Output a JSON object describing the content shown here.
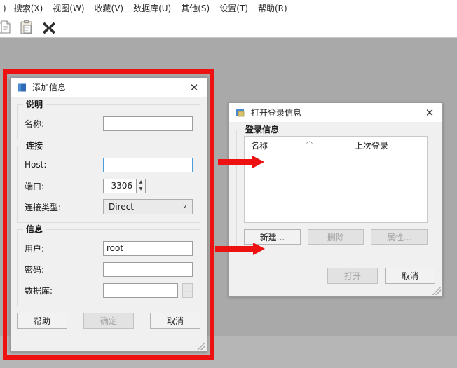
{
  "menubar": {
    "items": [
      {
        "label": ")"
      },
      {
        "label": "搜索(X)"
      },
      {
        "label": "视图(W)"
      },
      {
        "label": "收藏(V)"
      },
      {
        "label": "数据库(U)"
      },
      {
        "label": "其他(S)"
      },
      {
        "label": "设置(T)"
      },
      {
        "label": "帮助(R)"
      }
    ]
  },
  "toolbar": {
    "icons": [
      "copy-icon",
      "paste-icon",
      "delete-x-icon"
    ]
  },
  "add_dialog": {
    "title": "添加信息",
    "close_label": "✕",
    "groups": {
      "description": {
        "label": "说明",
        "name_label": "名称:",
        "name_value": ""
      },
      "connection": {
        "label": "连接",
        "host_label": "Host:",
        "host_value": "",
        "port_label": "端口:",
        "port_value": "3306",
        "type_label": "连接类型:",
        "type_value": "Direct",
        "type_options": [
          "Direct"
        ]
      },
      "info": {
        "label": "信息",
        "user_label": "用户:",
        "user_value": "root",
        "password_label": "密码:",
        "password_value": "",
        "database_label": "数据库:",
        "database_value": "",
        "browse_label": "..."
      }
    },
    "buttons": {
      "help": "帮助",
      "ok": "确定",
      "cancel": "取消"
    }
  },
  "open_dialog": {
    "title": "打开登录信息",
    "close_label": "✕",
    "group_label": "登录信息",
    "columns": [
      "名称",
      "上次登录"
    ],
    "sort_indicator": "︿",
    "rows": [],
    "buttons": {
      "new": "新建...",
      "delete": "删除",
      "properties": "属性...",
      "open": "打开",
      "cancel": "取消"
    }
  },
  "annotations": {
    "highlight_color": "#ee1111",
    "arrows": [
      {
        "name": "arrow-to-list"
      },
      {
        "name": "arrow-to-new-button"
      }
    ]
  }
}
